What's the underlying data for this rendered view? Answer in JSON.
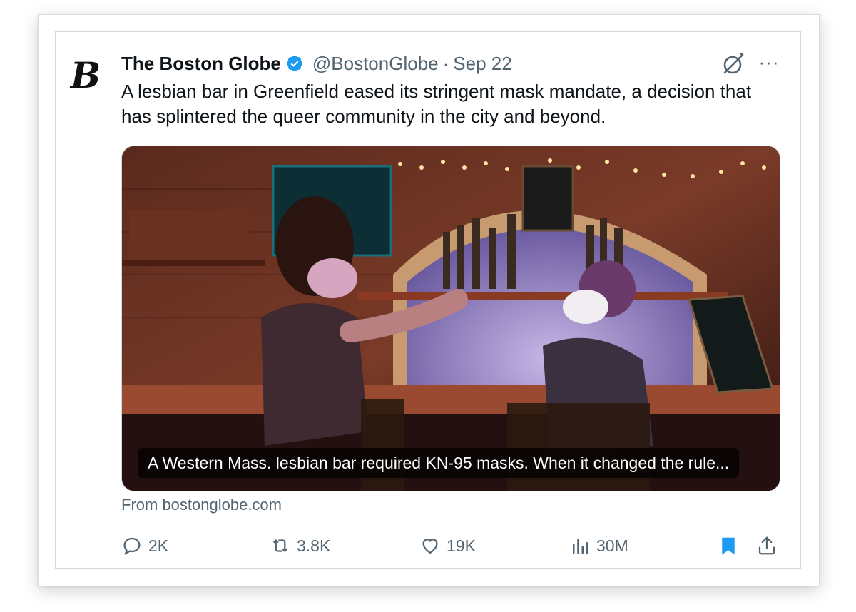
{
  "tweet": {
    "author_name": "The Boston Globe",
    "avatar_letter": "B",
    "handle": "@BostonGlobe",
    "separator": "·",
    "date": "Sep 22",
    "text": "A lesbian bar in Greenfield eased its stringent mask mandate, a decision that has splintered the queer community in the city and beyond.",
    "more_label": "···",
    "card": {
      "caption": "A Western Mass. lesbian bar required KN-95 masks. When it changed the rule...",
      "source": "From bostonglobe.com"
    },
    "stats": {
      "replies": "2K",
      "reposts": "3.8K",
      "likes": "19K",
      "views": "30M"
    }
  },
  "colors": {
    "verified": "#1d9bf0",
    "bookmark_active": "#1d9bf0",
    "muted_text": "#536471"
  },
  "icons": [
    "reply-icon",
    "repost-icon",
    "like-icon",
    "views-icon",
    "bookmark-icon",
    "share-icon",
    "grok-icon",
    "more-icon",
    "verified-icon"
  ]
}
